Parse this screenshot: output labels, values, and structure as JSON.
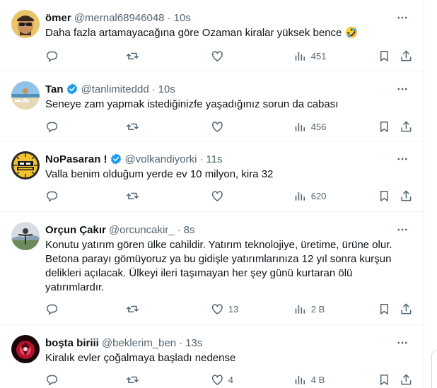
{
  "tweets": [
    {
      "name": "ömer",
      "handle": "@mernal68946048",
      "sep": "·",
      "time": "10s",
      "verified": false,
      "text": "Daha fazla artamayacağına göre Ozaman kiralar yüksek bence 🤣",
      "views": "451",
      "likes": "",
      "avatar": "man-with-sunglasses-avatar"
    },
    {
      "name": "Tan",
      "handle": "@tanlimiteddd",
      "sep": "·",
      "time": "10s",
      "verified": true,
      "text": "Seneye zam yapmak istediğinizfe yaşadığınız sorun da cabası",
      "views": "456",
      "likes": "",
      "avatar": "beach-photo-avatar"
    },
    {
      "name": "NoPasaran !",
      "handle": "@volkandiyorki",
      "sep": "·",
      "time": "11s",
      "verified": true,
      "text": "Valla benim olduğum yerde ev 10 milyon, kira 32",
      "views": "620",
      "likes": "",
      "avatar": "no-pasaran-logo-avatar"
    },
    {
      "name": "Orçun Çakır",
      "handle": "@orcuncakir_",
      "sep": "·",
      "time": "8s",
      "verified": false,
      "text": "Konutu yatırım gören ülke cahildir. Yatırım teknolojiye, üretime, ürüne olur. Betona parayı gömüyoruz ya bu gidişle yatırımlarınıza 12 yıl sonra kurşun delikleri açılacak. Ülkeyi ileri taşımayan her şey günü kurtaran ölü yatırımlardır.",
      "views": "2 B",
      "likes": "13",
      "avatar": "person-outdoors-avatar"
    },
    {
      "name": "boşta biriii",
      "handle": "@beklerim_ben",
      "sep": "·",
      "time": "13s",
      "verified": false,
      "text": "Kiralık evler çoğalmaya başladı nedense",
      "views": "4 B",
      "likes": "4",
      "avatar": "red-emblem-avatar"
    }
  ],
  "colors": {
    "text": "#0f1419",
    "secondary": "#536471",
    "verified": "#1d9bf0",
    "border": "#eff3f4"
  },
  "icons": [
    "reply-icon",
    "retweet-icon",
    "like-icon",
    "views-icon",
    "bookmark-icon",
    "share-icon",
    "more-icon",
    "verified-badge-icon"
  ]
}
